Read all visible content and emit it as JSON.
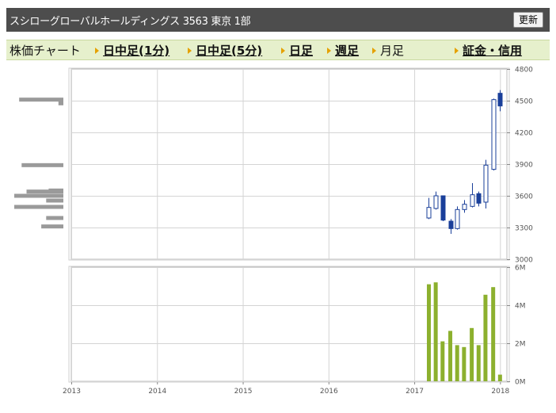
{
  "header": {
    "title": "スシローグローバルホールディングス  3563  東京 1部",
    "refresh_label": "更新"
  },
  "tabs": [
    {
      "label": "株価チャート",
      "link": false,
      "arrow": false
    },
    {
      "label": "日中足(1分)",
      "link": true,
      "arrow": true
    },
    {
      "label": "日中足(5分)",
      "link": true,
      "arrow": true
    },
    {
      "label": "日足",
      "link": true,
      "arrow": true
    },
    {
      "label": "週足",
      "link": true,
      "arrow": true
    },
    {
      "label": "月足",
      "link": false,
      "arrow": true
    },
    {
      "label": "証金・信用",
      "link": true,
      "arrow": true
    }
  ],
  "chart_data": [
    {
      "type": "candlestick",
      "y_ticks": [
        "3000",
        "3300",
        "3600",
        "3900",
        "4200",
        "4500",
        "4800"
      ],
      "ylim": [
        3000,
        4800
      ],
      "xlim": [
        2013.0,
        2018.08
      ],
      "candle_color_up": "#ffffff",
      "candle_color_down": "#1a3f9a",
      "candles": [
        {
          "t": 2017.17,
          "open": 3390,
          "high": 3580,
          "low": 3380,
          "close": 3490
        },
        {
          "t": 2017.25,
          "open": 3480,
          "high": 3640,
          "low": 3470,
          "close": 3600
        },
        {
          "t": 2017.33,
          "open": 3600,
          "high": 3600,
          "low": 3360,
          "close": 3370
        },
        {
          "t": 2017.42,
          "open": 3360,
          "high": 3380,
          "low": 3240,
          "close": 3290
        },
        {
          "t": 2017.5,
          "open": 3290,
          "high": 3500,
          "low": 3280,
          "close": 3470
        },
        {
          "t": 2017.58,
          "open": 3470,
          "high": 3560,
          "low": 3440,
          "close": 3520
        },
        {
          "t": 2017.67,
          "open": 3500,
          "high": 3720,
          "low": 3490,
          "close": 3610
        },
        {
          "t": 2017.75,
          "open": 3620,
          "high": 3640,
          "low": 3500,
          "close": 3530
        },
        {
          "t": 2017.83,
          "open": 3540,
          "high": 3940,
          "low": 3480,
          "close": 3890
        },
        {
          "t": 2017.92,
          "open": 3850,
          "high": 4520,
          "low": 3840,
          "close": 4510
        },
        {
          "t": 2018.0,
          "open": 4570,
          "high": 4600,
          "low": 4400,
          "close": 4450
        }
      ],
      "volume_by_price": [
        {
          "price": 4510,
          "volume": 0.9
        },
        {
          "price": 4475,
          "volume": 0.1
        },
        {
          "price": 3890,
          "volume": 0.85
        },
        {
          "price": 3650,
          "volume": 0.3
        },
        {
          "price": 3640,
          "volume": 0.75
        },
        {
          "price": 3600,
          "volume": 1.0
        },
        {
          "price": 3555,
          "volume": 0.35
        },
        {
          "price": 3495,
          "volume": 1.0
        },
        {
          "price": 3390,
          "volume": 0.35
        },
        {
          "price": 3310,
          "volume": 0.45
        }
      ]
    },
    {
      "type": "bar",
      "y_ticks": [
        "0M",
        "2M",
        "4M",
        "6M"
      ],
      "ylim": [
        0,
        6
      ],
      "color": "#8cb02e",
      "x": [
        2017.17,
        2017.25,
        2017.33,
        2017.42,
        2017.5,
        2017.58,
        2017.67,
        2017.75,
        2017.83,
        2017.92,
        2018.0
      ],
      "values": [
        5.1,
        5.2,
        2.1,
        2.65,
        1.9,
        1.8,
        2.8,
        1.9,
        4.55,
        4.95,
        0.35
      ]
    }
  ],
  "x_ticks": [
    "2013",
    "2014",
    "2015",
    "2016",
    "2017",
    "2018"
  ]
}
